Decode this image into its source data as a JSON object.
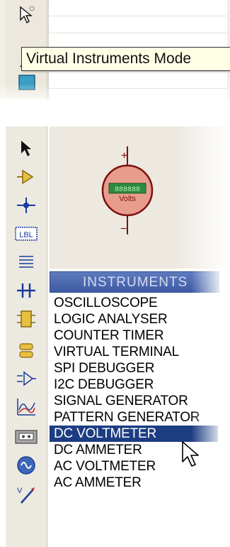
{
  "tooltip": {
    "text": "Virtual Instruments Mode"
  },
  "preview": {
    "meter_unit": "Volts",
    "plus_sign": "+",
    "minus_sign": "−"
  },
  "instruments": {
    "header": "INSTRUMENTS",
    "selected_index": 8,
    "items": [
      "OSCILLOSCOPE",
      "LOGIC ANALYSER",
      "COUNTER TIMER",
      "VIRTUAL TERMINAL",
      "SPI DEBUGGER",
      "I2C DEBUGGER",
      "SIGNAL GENERATOR",
      "PATTERN GENERATOR",
      "DC VOLTMETER",
      "DC AMMETER",
      "AC VOLTMETER",
      "AC AMMETER"
    ]
  },
  "toolbar": {
    "top_tools": [
      "pointer-icon",
      "wire-icon",
      "square-icon"
    ],
    "tools": [
      "selection-arrow-icon",
      "component-icon",
      "junction-dot-icon",
      "wire-label-icon",
      "text-script-icon",
      "buses-icon",
      "subcircuit-icon",
      "terminals-icon",
      "device-pins-icon",
      "graph-icon",
      "tape-recorder-icon",
      "generator-icon",
      "voltage-probe-icon"
    ]
  },
  "colors": {
    "header_bg": "#3d5aa3",
    "selection_bg": "#1d3d83",
    "meter_face": "#e89c8c",
    "meter_display": "#2d8a3e",
    "tooltip_bg": "#ffffe6"
  }
}
